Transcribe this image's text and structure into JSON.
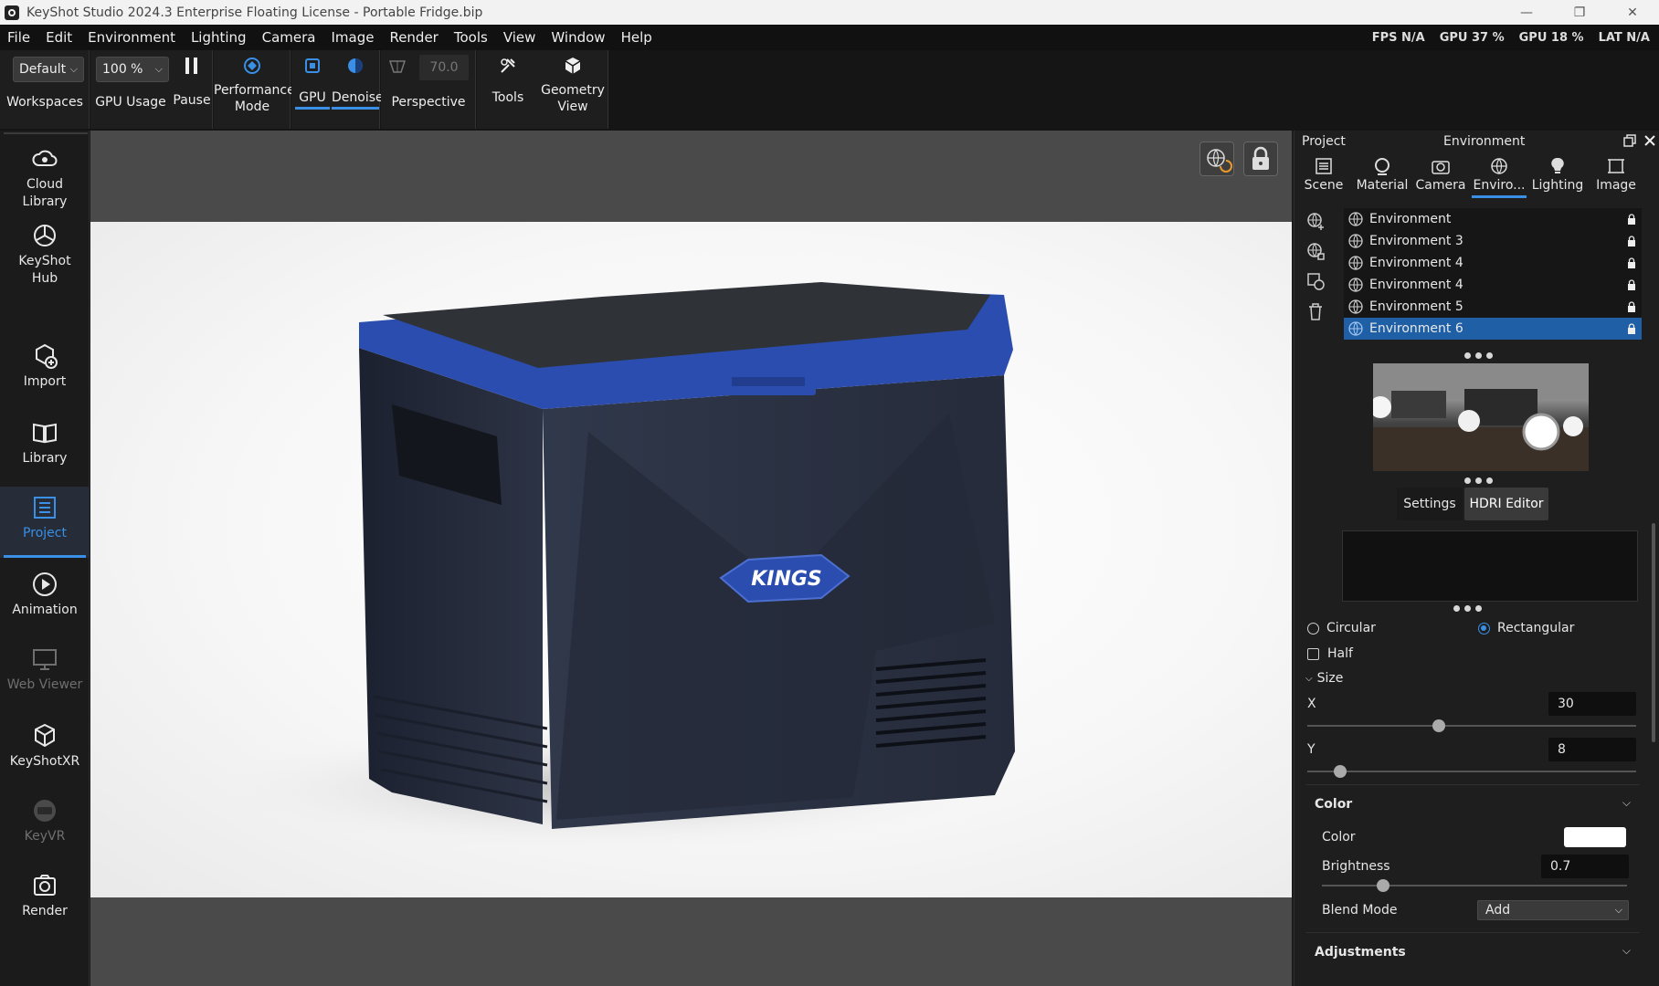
{
  "titlebar": {
    "title": "KeyShot Studio 2024.3 Enterprise Floating License - Portable Fridge.bip",
    "stats": [
      "FPS N/A",
      "GPU 37 %",
      "GPU 18 %",
      "LAT N/A"
    ],
    "minimize": "—",
    "maximize": "❐",
    "close": "✕"
  },
  "menu": [
    "File",
    "Edit",
    "Environment",
    "Lighting",
    "Camera",
    "Image",
    "Render",
    "Tools",
    "View",
    "Window",
    "Help"
  ],
  "toolbar": {
    "workspace_value": "Default",
    "workspaces_label": "Workspaces",
    "gpu_usage_value": "100 %",
    "gpu_usage_label": "GPU Usage",
    "pause_label": "Pause",
    "performance_label_1": "Performance",
    "performance_label_2": "Mode",
    "gpu_label": "GPU",
    "denoise_label": "Denoise",
    "fov_value": "70.0",
    "perspective_label": "Perspective",
    "tools_label": "Tools",
    "geometry_label_1": "Geometry",
    "geometry_label_2": "View"
  },
  "sidebar": {
    "items": [
      {
        "label1": "Cloud",
        "label2": "Library"
      },
      {
        "label1": "KeyShot",
        "label2": "Hub"
      },
      {
        "label1": "Import",
        "label2": ""
      },
      {
        "label1": "Library",
        "label2": ""
      },
      {
        "label1": "Project",
        "label2": ""
      },
      {
        "label1": "Animation",
        "label2": ""
      },
      {
        "label1": "Web Viewer",
        "label2": ""
      },
      {
        "label1": "KeyShotXR",
        "label2": ""
      },
      {
        "label1": "KeyVR",
        "label2": ""
      },
      {
        "label1": "Render",
        "label2": ""
      }
    ]
  },
  "viewport": {
    "badge_text": "KINGS"
  },
  "panel": {
    "project_label": "Project",
    "header_title": "Environment",
    "tabs": [
      "Scene",
      "Material",
      "Camera",
      "Enviro...",
      "Lighting",
      "Image"
    ],
    "environments": [
      "Environment",
      "Environment 3",
      "Environment 4",
      "Environment 4",
      "Environment 5",
      "Environment 6"
    ],
    "settings_label": "Settings",
    "hdri_editor_label": "HDRI Editor",
    "circular_label": "Circular",
    "rectangular_label": "Rectangular",
    "half_label": "Half",
    "size_label": "Size",
    "x_label": "X",
    "x_value": "30",
    "y_label": "Y",
    "y_value": "8",
    "color_section": "Color",
    "color_label": "Color",
    "brightness_label": "Brightness",
    "brightness_value": "0.7",
    "blend_label": "Blend Mode",
    "blend_value": "Add",
    "adjustments_section": "Adjustments",
    "x_slider_fraction": 0.4,
    "y_slider_fraction": 0.1,
    "brightness_slider_fraction": 0.2
  },
  "colors": {
    "accent": "#3a8fe6",
    "selection": "#1f5fa6",
    "fridge_blue": "#2b4db0",
    "fridge_body": "#2a2f3c"
  }
}
